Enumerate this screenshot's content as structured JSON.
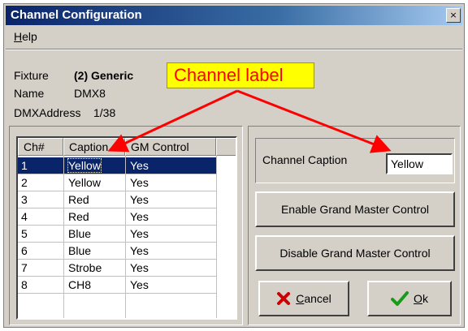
{
  "window": {
    "title": "Channel Configuration",
    "close_glyph": "×"
  },
  "menu": {
    "help_mnemonic": "H",
    "help_rest": "elp"
  },
  "info": {
    "fixture_label": "Fixture",
    "fixture_value": "(2)  Generic",
    "name_label": "Name",
    "name_value": "DMX8",
    "dmx_label": "DMXAddress",
    "dmx_value": "1/38"
  },
  "callout": {
    "text": "Channel label",
    "colors": {
      "bg": "#ffff00",
      "text": "#ff0000",
      "arrow": "#ff0000"
    }
  },
  "table": {
    "headers": [
      "Ch#",
      "Caption",
      "GM Control"
    ],
    "rows": [
      {
        "ch": "1",
        "caption": "Yellow",
        "gm": "Yes"
      },
      {
        "ch": "2",
        "caption": "Yellow",
        "gm": "Yes"
      },
      {
        "ch": "3",
        "caption": "Red",
        "gm": "Yes"
      },
      {
        "ch": "4",
        "caption": "Red",
        "gm": "Yes"
      },
      {
        "ch": "5",
        "caption": "Blue",
        "gm": "Yes"
      },
      {
        "ch": "6",
        "caption": "Blue",
        "gm": "Yes"
      },
      {
        "ch": "7",
        "caption": "Strobe",
        "gm": "Yes"
      },
      {
        "ch": "8",
        "caption": "CH8",
        "gm": "Yes"
      }
    ],
    "selected_row": 0,
    "selection_color": "#0a246a"
  },
  "caption_field": {
    "label": "Channel Caption",
    "value": "Yellow"
  },
  "buttons": {
    "enable_gm": "Enable Grand Master Control",
    "disable_gm": "Disable Grand Master Control",
    "cancel_mnemonic": "C",
    "cancel_rest": "ancel",
    "ok_mnemonic": "O",
    "ok_rest": "k"
  },
  "icons": {
    "cancel": "red-x-icon",
    "ok": "green-check-icon"
  }
}
